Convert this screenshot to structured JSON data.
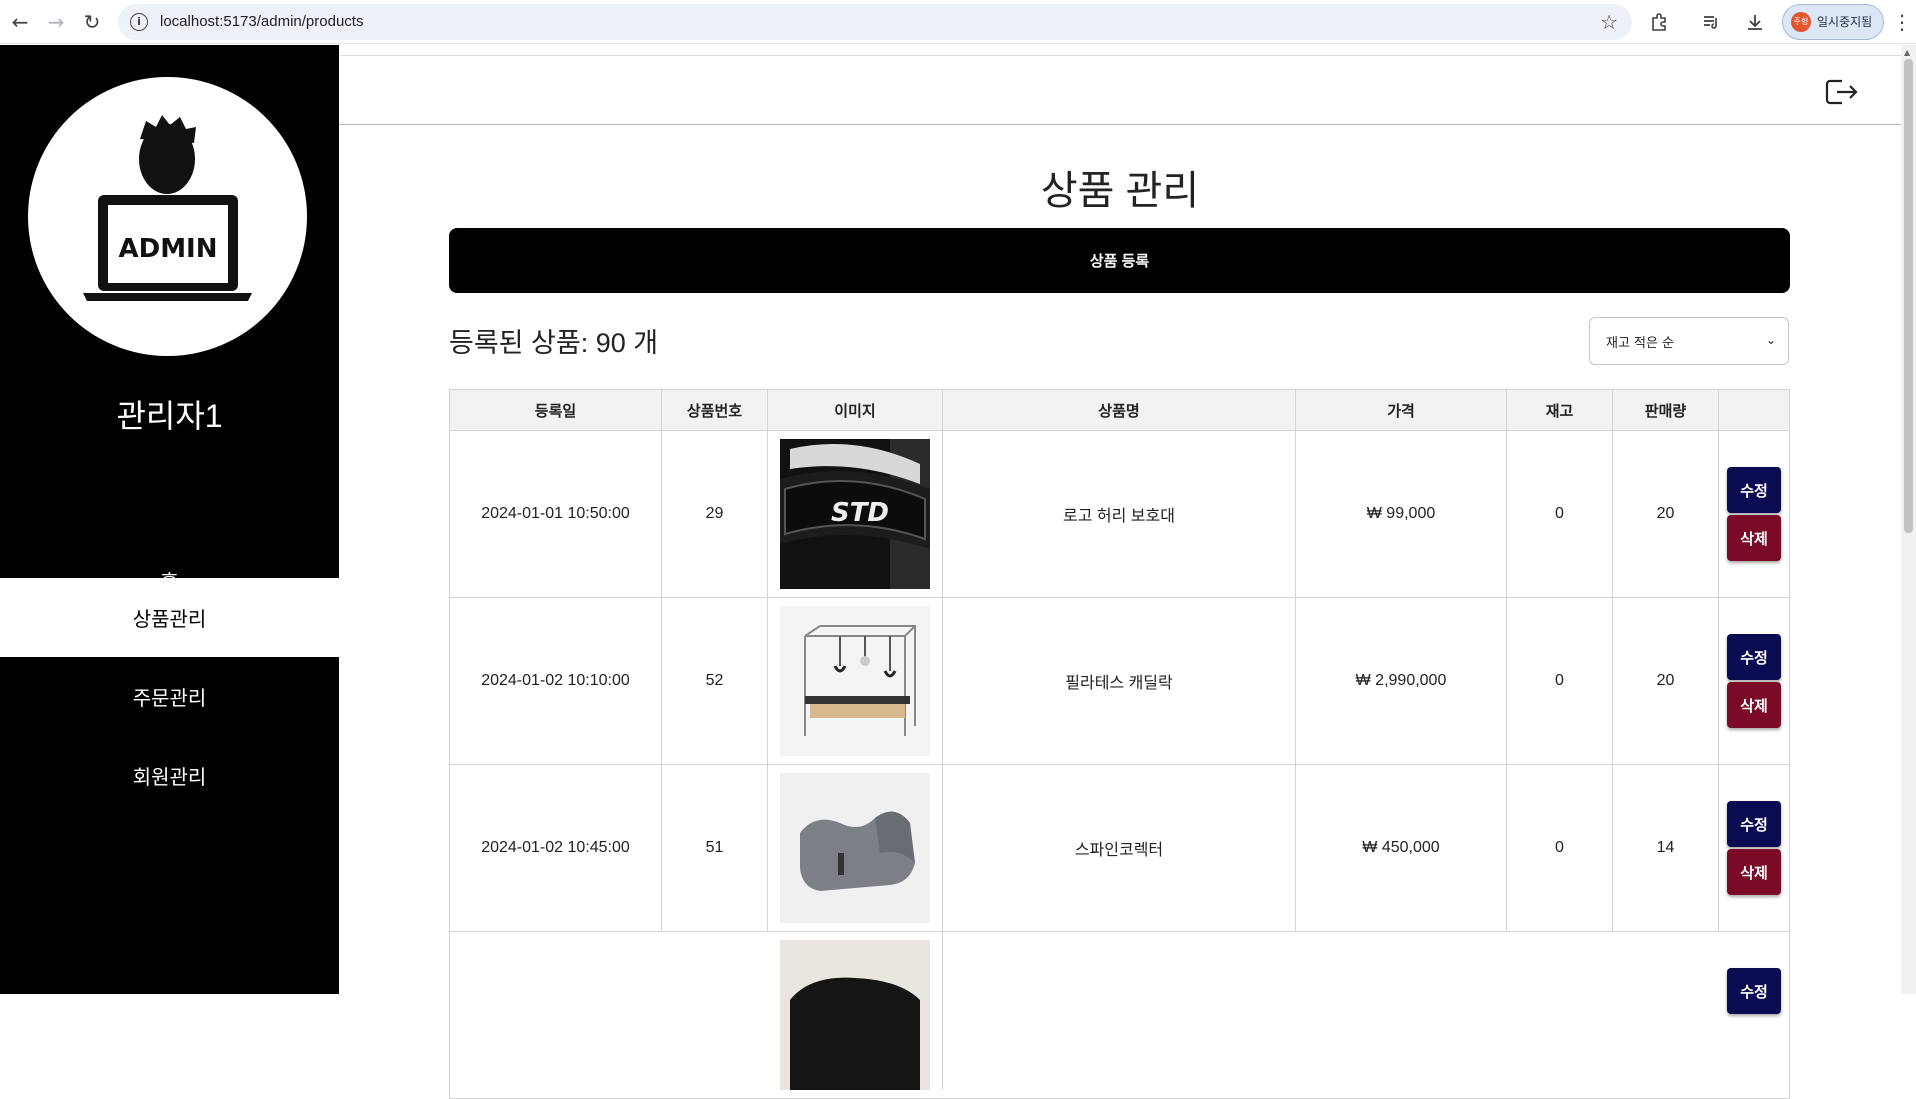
{
  "browser": {
    "url": "localhost:5173/admin/products",
    "profile_label": "일시중지됨",
    "profile_badge": "주형"
  },
  "sidebar": {
    "avatar_text": "ADMIN",
    "admin_name": "관리자1",
    "items": [
      {
        "label": "홈",
        "active": false
      },
      {
        "label": "상품관리",
        "active": true
      },
      {
        "label": "주문관리",
        "active": false
      },
      {
        "label": "회원관리",
        "active": false
      }
    ]
  },
  "main": {
    "title": "상품 관리",
    "register_button": "상품 등록",
    "count_label": "등록된 상품: 90 개",
    "sort": {
      "selected": "재고 적은 순"
    },
    "table": {
      "headers": [
        "등록일",
        "상품번호",
        "이미지",
        "상품명",
        "가격",
        "재고",
        "판매량",
        ""
      ],
      "rows": [
        {
          "date": "2024-01-01 10:50:00",
          "id": "29",
          "name": "로고 허리 보호대",
          "price": "₩ 99,000",
          "stock": "0",
          "sales": "20"
        },
        {
          "date": "2024-01-02 10:10:00",
          "id": "52",
          "name": "필라테스 캐딜락",
          "price": "₩ 2,990,000",
          "stock": "0",
          "sales": "20"
        },
        {
          "date": "2024-01-02 10:45:00",
          "id": "51",
          "name": "스파인코렉터",
          "price": "₩ 450,000",
          "stock": "0",
          "sales": "14"
        },
        {
          "date": "",
          "id": "",
          "name": "",
          "price": "",
          "stock": "",
          "sales": ""
        }
      ],
      "edit_label": "수정",
      "delete_label": "삭제"
    }
  },
  "colors": {
    "sidebar_bg": "#000000",
    "edit_button": "#0b0b52",
    "delete_button": "#7b0a26"
  }
}
